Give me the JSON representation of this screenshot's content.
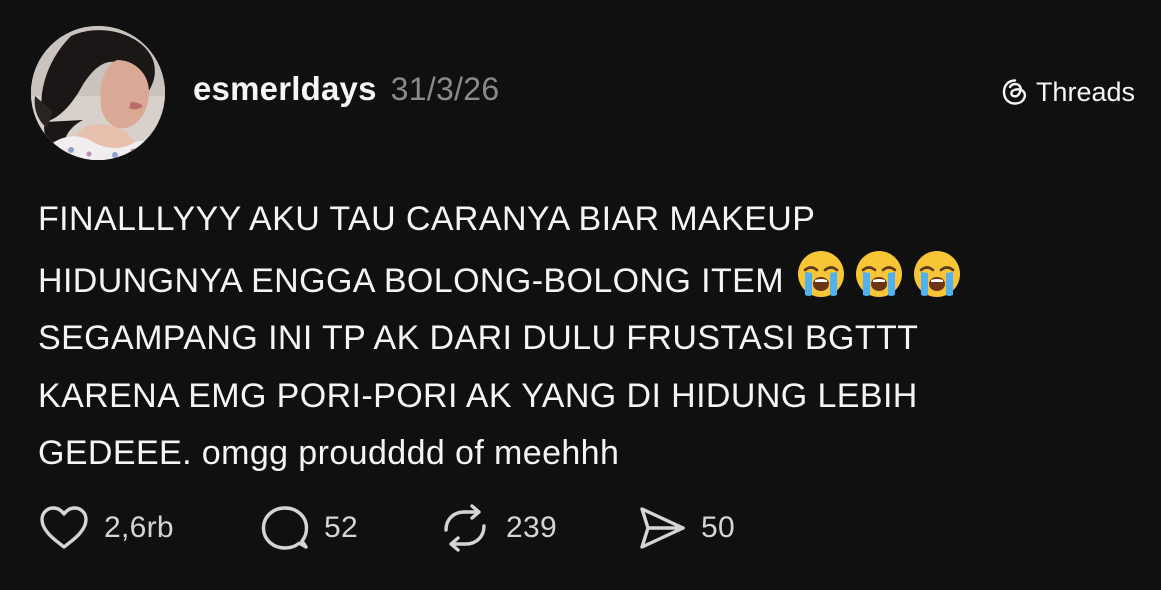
{
  "author": {
    "username": "esmerldays",
    "date": "31/3/26"
  },
  "brand": {
    "label": "Threads",
    "icon": "threads-logo-icon"
  },
  "post": {
    "lines": [
      "FINALLLYYY AKU TAU CARANYA BIAR MAKEUP",
      "HIDUNGNYA ENGGA BOLONG-BOLONG ITEM",
      "SEGAMPANG INI TP AK DARI DULU FRUSTASI BGTTT",
      "KARENA EMG PORI-PORI AK YANG DI HIDUNG LEBIH",
      "GEDEEE. omgg proudddd of meehhh"
    ],
    "emojis": [
      "loudly-crying-face-icon",
      "loudly-crying-face-icon",
      "loudly-crying-face-icon"
    ]
  },
  "actions": {
    "likes": "2,6rb",
    "replies": "52",
    "reposts": "239",
    "shares": "50"
  },
  "colors": {
    "background": "#101010",
    "text": "#f3f5f7",
    "muted": "#8a8a8a"
  }
}
